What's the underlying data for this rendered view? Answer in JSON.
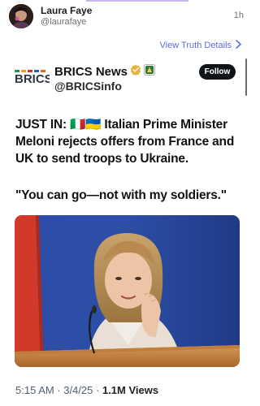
{
  "post": {
    "author_name": "Laura Faye",
    "author_handle": "@laurafaye",
    "time": "1h",
    "view_truth_label": "View Truth Details"
  },
  "tweet": {
    "account_name": "BRICS News",
    "account_handle": "@BRICSinfo",
    "follow_label": "Follow",
    "logo_text": "BRICS",
    "text_prefix": "JUST IN:",
    "flags": "🇮🇹🇺🇦",
    "text_body": "Italian Prime Minister Meloni rejects offers from France and UK to send troops to Ukraine.",
    "quote": "\"You can go—not with my soldiers.\"",
    "timestamp": "5:15 AM · 3/4/25 ·",
    "views_count": "1.1M",
    "views_label": "Views"
  },
  "colors": {
    "link": "#5b6ee0",
    "verified_gold": "#e5b23a",
    "follow_bg": "#0f1419"
  },
  "icons": [
    "avatar-photo",
    "brics-logo",
    "verified-badge-icon",
    "affiliate-badge-icon",
    "chevron-right-icon"
  ]
}
